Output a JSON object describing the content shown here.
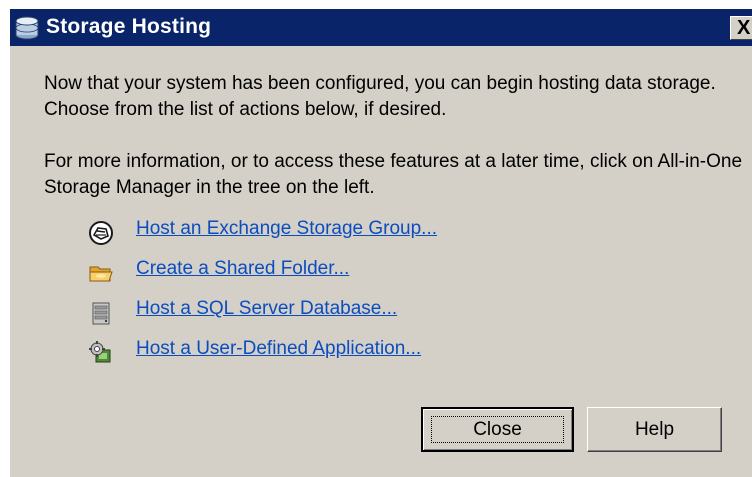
{
  "window": {
    "title": "Storage Hosting",
    "close_glyph": "X",
    "title_icon": "storage-disk-icon"
  },
  "body": {
    "paragraph1": "Now that your system has been configured, you can begin hosting data storage.  Choose from the list of actions below, if desired.",
    "paragraph2": "For more information, or to access these features at a later time, click on All-in-One Storage Manager in the tree on the left."
  },
  "actions": [
    {
      "label": "Host an Exchange Storage Group...",
      "icon": "exchange-icon"
    },
    {
      "label": "Create a Shared Folder...",
      "icon": "folder-icon"
    },
    {
      "label": "Host a SQL Server Database...",
      "icon": "database-server-icon"
    },
    {
      "label": "Host a User-Defined Application...",
      "icon": "application-icon"
    }
  ],
  "buttons": {
    "close": "Close",
    "help": "Help"
  },
  "colors": {
    "titlebar": "#0a246a",
    "dialog_bg": "#d4d0c8",
    "link": "#0b4dbf"
  }
}
